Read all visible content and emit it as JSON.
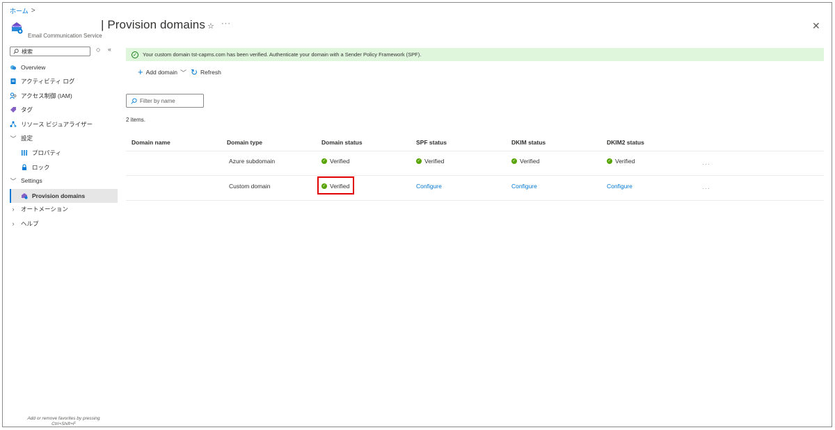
{
  "breadcrumb": {
    "home": "ホーム",
    "separator": ">"
  },
  "header": {
    "title": "| Provision domains",
    "subtitle": "Email Communication Service",
    "star_icon": "star-icon",
    "more": "···",
    "close": "✕"
  },
  "sidebar": {
    "search_placeholder": "検索",
    "collapse_label": "«",
    "items": [
      {
        "label": "Overview",
        "icon": "cloud-icon"
      },
      {
        "label": "アクティビティ ログ",
        "icon": "log-icon"
      },
      {
        "label": "アクセス制御 (IAM)",
        "icon": "people-icon"
      },
      {
        "label": "タグ",
        "icon": "tag-icon"
      },
      {
        "label": "リソース ビジュアライザー",
        "icon": "visualizer-icon"
      },
      {
        "label": "設定",
        "icon": "chevron-down-icon"
      },
      {
        "label": "プロパティ",
        "icon": "properties-icon"
      },
      {
        "label": "ロック",
        "icon": "lock-icon"
      },
      {
        "label": "Settings",
        "icon": "chevron-down-icon"
      },
      {
        "label": "Provision domains",
        "icon": "domain-icon"
      },
      {
        "label": "オートメーション",
        "icon": "chevron-right-icon"
      },
      {
        "label": "ヘルプ",
        "icon": "chevron-right-icon"
      }
    ],
    "favorites_hint_line1": "Add or remove favorites by pressing",
    "favorites_hint_line2": "Ctrl+Shift+F"
  },
  "banner": {
    "text": "Your custom domain tst-capms.com has been verified. Authenticate your domain with a Sender Policy Framework (SPF)."
  },
  "toolbar": {
    "add_domain": "Add domain",
    "refresh": "Refresh"
  },
  "filter": {
    "placeholder": "Filter by name"
  },
  "table": {
    "count": "2 items.",
    "headers": [
      "Domain name",
      "Domain type",
      "Domain status",
      "SPF status",
      "DKIM status",
      "DKIM2 status"
    ],
    "rows": [
      {
        "name": "",
        "type": "Azure subdomain",
        "status": "Verified",
        "spf": "Verified",
        "dkim": "Verified",
        "dkim2": "Verified",
        "more": "···"
      },
      {
        "name": "",
        "type": "Custom domain",
        "status": "Verified",
        "spf": "Configure",
        "dkim": "Configure",
        "dkim2": "Configure",
        "more": "···"
      }
    ]
  },
  "colors": {
    "accent": "#0078d4",
    "success": "#57a300",
    "banner_bg": "#dff6dd",
    "highlight": "#e00000"
  }
}
